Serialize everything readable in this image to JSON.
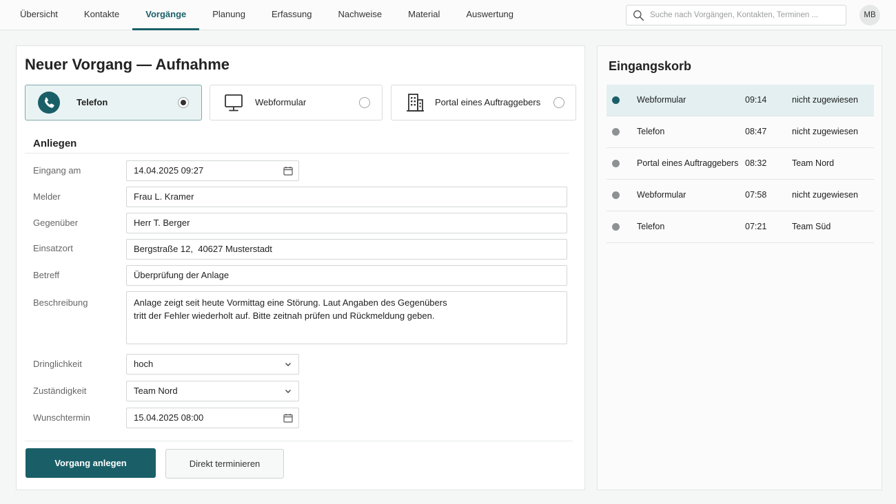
{
  "nav": {
    "items": [
      {
        "label": "Übersicht",
        "active": false
      },
      {
        "label": "Kontakte",
        "active": false
      },
      {
        "label": "Vorgänge",
        "active": true
      },
      {
        "label": "Planung",
        "active": false
      },
      {
        "label": "Erfassung",
        "active": false
      },
      {
        "label": "Nachweise",
        "active": false
      },
      {
        "label": "Material",
        "active": false
      },
      {
        "label": "Auswertung",
        "active": false
      }
    ],
    "search_placeholder": "Suche nach Vorgängen, Kontakten, Terminen ...",
    "user_initials": "MB"
  },
  "form": {
    "title": "Neuer Vorgang — Aufnahme",
    "channels": [
      {
        "label": "Telefon",
        "icon": "phone-icon",
        "selected": true
      },
      {
        "label": "Webformular",
        "icon": "monitor-icon",
        "selected": false
      },
      {
        "label": "Portal eines Auftraggebers",
        "icon": "building-icon",
        "selected": false
      }
    ],
    "section_title": "Anliegen",
    "fields": {
      "eingang": {
        "label": "Eingang am",
        "value": "14.04.2025  09:27"
      },
      "melder": {
        "label": "Melder",
        "value": "Frau L. Kramer"
      },
      "gegenueber": {
        "label": "Gegenüber",
        "value": "Herr T. Berger"
      },
      "einsatzort": {
        "label": "Einsatzort",
        "value": "Bergstraße 12,  40627 Musterstadt"
      },
      "betreff": {
        "label": "Betreff",
        "value": "Überprüfung der Anlage"
      },
      "beschreibung": {
        "label": "Beschreibung",
        "line1": "Anlage zeigt seit heute Vormittag eine Störung. Laut Angaben des Gegenübers",
        "line2": "tritt der Fehler wiederholt auf. Bitte zeitnah prüfen und Rückmeldung geben."
      },
      "dringlichkeit": {
        "label": "Dringlichkeit",
        "value": "hoch"
      },
      "zustaendigkeit": {
        "label": "Zuständigkeit",
        "value": "Team Nord"
      },
      "wunschtermin": {
        "label": "Wunschtermin",
        "value": "15.04.2025  08:00"
      }
    },
    "primary_button": "Vorgang anlegen",
    "secondary_button": "Direkt terminieren"
  },
  "inbox": {
    "title": "Eingangskorb",
    "rows": [
      {
        "channel": "Webformular",
        "time": "09:14",
        "assignment": "nicht zugewiesen",
        "active": true
      },
      {
        "channel": "Telefon",
        "time": "08:47",
        "assignment": "nicht zugewiesen",
        "active": false
      },
      {
        "channel": "Portal eines Auftraggebers",
        "time": "08:32",
        "assignment": "Team Nord",
        "active": false
      },
      {
        "channel": "Webformular",
        "time": "07:58",
        "assignment": "nicht zugewiesen",
        "active": false
      },
      {
        "channel": "Telefon",
        "time": "07:21",
        "assignment": "Team Süd",
        "active": false
      }
    ]
  },
  "colors": {
    "accent": "#1a5f68",
    "selected_bg": "#eaf3f3",
    "inbox_active_bg": "#e3eff0"
  }
}
